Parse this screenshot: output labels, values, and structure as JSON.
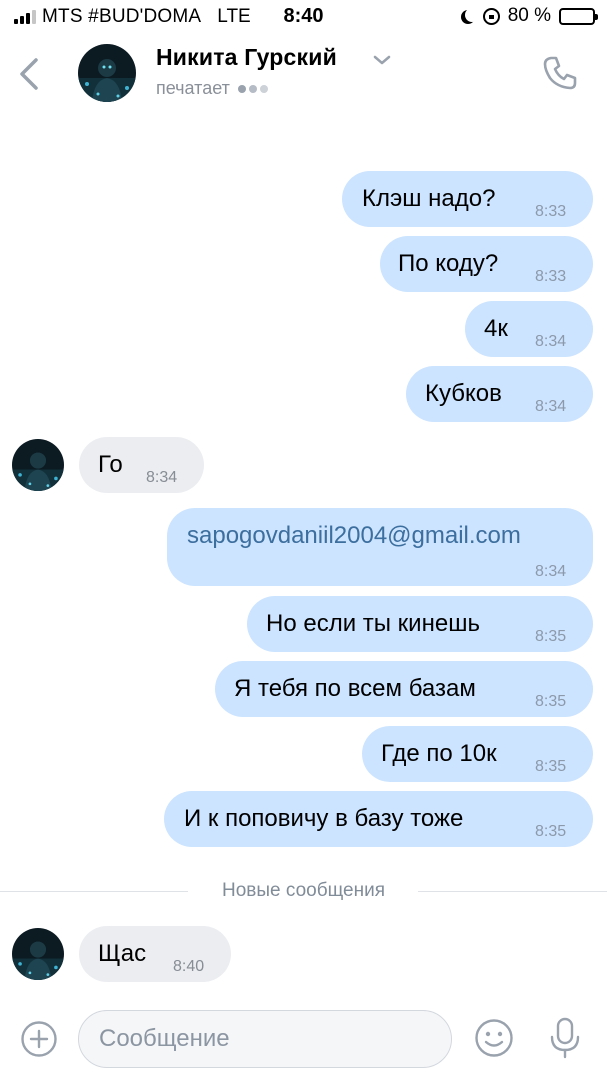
{
  "status_bar": {
    "carrier": "MTS #BUD'DOMA",
    "network": "LTE",
    "time": "8:40",
    "battery": "80 %",
    "battery_level": 0.8
  },
  "header": {
    "name": "Никита Гурский",
    "status": "печатает"
  },
  "messages": [
    {
      "text": "Клэш надо?",
      "time": "8:33"
    },
    {
      "text": "По коду?",
      "time": "8:33"
    },
    {
      "text": "4к",
      "time": "8:34"
    },
    {
      "text": "Кубков",
      "time": "8:34"
    },
    {
      "text": "Го",
      "time": "8:34"
    },
    {
      "text": "sapogovdaniil2004@gmail.com",
      "time": "8:34"
    },
    {
      "text": "Но если ты кинешь",
      "time": "8:35"
    },
    {
      "text": "Я тебя по всем базам",
      "time": "8:35"
    },
    {
      "text": "Где по 10к",
      "time": "8:35"
    },
    {
      "text": "И к поповичу в базу тоже",
      "time": "8:35"
    },
    {
      "text": "Щас",
      "time": "8:40"
    }
  ],
  "separator": {
    "label": "Новые сообщения"
  },
  "composer": {
    "placeholder": "Сообщение"
  },
  "colors": {
    "outgoing_bubble": "#cce4ff",
    "incoming_bubble": "#ebedf0",
    "link": "#3c6e9e",
    "secondary_text": "#818c99",
    "icon": "#99a2ad"
  },
  "icons": [
    "back-chevron-icon",
    "chevron-down-icon",
    "phone-icon",
    "plus-icon",
    "smile-icon",
    "microphone-icon"
  ]
}
